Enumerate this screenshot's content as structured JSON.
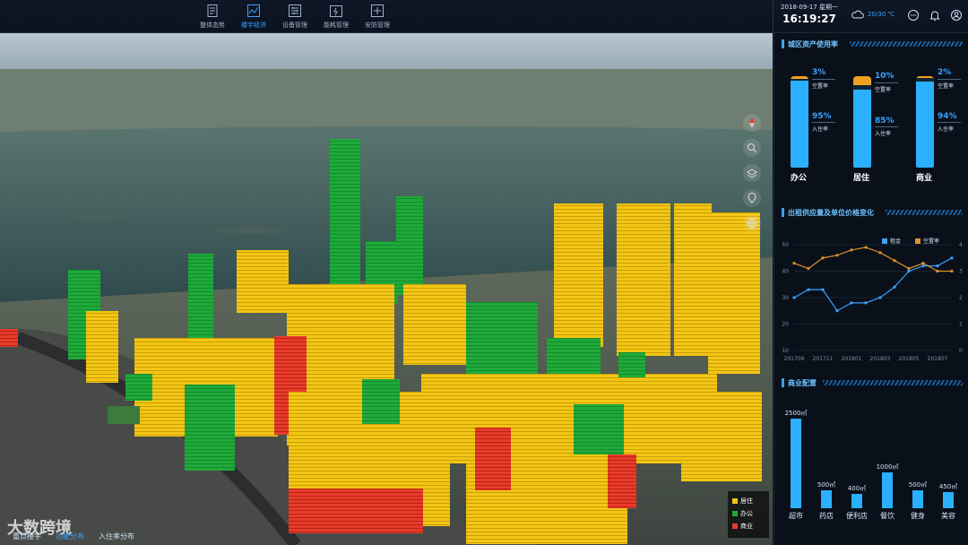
{
  "nav": {
    "items": [
      {
        "label": "整体态势",
        "icon": "document-icon"
      },
      {
        "label": "楼宇经济",
        "icon": "line-chart-icon",
        "active": true
      },
      {
        "label": "设备管理",
        "icon": "sliders-icon"
      },
      {
        "label": "能耗管理",
        "icon": "energy-icon"
      },
      {
        "label": "安防管理",
        "icon": "security-icon"
      }
    ]
  },
  "header": {
    "date": "2018-09-17 星期一",
    "time": "16:19:27",
    "weather": "20/30 ℃",
    "weather_icon": "cloud-icon",
    "icons": [
      "chat-icon",
      "bell-icon",
      "user-icon"
    ]
  },
  "panel1": {
    "title": "城区资产使用率",
    "vacancy_label": "空置率",
    "occupancy_label": "入住率",
    "items": [
      {
        "name": "办公",
        "vacancy": "3%",
        "occupancy": "95%",
        "vac": 3,
        "occ": 95
      },
      {
        "name": "居住",
        "vacancy": "10%",
        "occupancy": "85%",
        "vac": 10,
        "occ": 85
      },
      {
        "name": "商业",
        "vacancy": "2%",
        "occupancy": "94%",
        "vac": 2,
        "occ": 94
      }
    ]
  },
  "panel2": {
    "title": "出租供应量及单位价格变化",
    "legend_rent": "租金",
    "legend_vacancy": "空置率",
    "color_rent": "#3aa2ff",
    "color_vacancy": "#e0902a"
  },
  "chart_data": [
    {
      "type": "line",
      "title": "出租供应量及单位价格变化",
      "x": [
        "201709",
        "201710",
        "201711",
        "201712",
        "201801",
        "201802",
        "201803",
        "201804",
        "201805",
        "201806",
        "201807",
        "201808"
      ],
      "x_tick_labels": [
        "201709",
        "201711",
        "201801",
        "201803",
        "201805",
        "201807"
      ],
      "y_left_ticks": [
        "10",
        "20",
        "30",
        "40",
        "50"
      ],
      "y_right_ticks": [
        "0",
        "1",
        "2",
        "3",
        "4"
      ],
      "ylim_left": [
        10,
        50
      ],
      "ylim_right": [
        0,
        4
      ],
      "series": [
        {
          "name": "租金",
          "axis": "left",
          "color": "#3aa2ff",
          "values": [
            30,
            33,
            33,
            25,
            28,
            28,
            30,
            34,
            40,
            42,
            42,
            45
          ]
        },
        {
          "name": "空置率",
          "axis": "right",
          "color": "#e0902a",
          "values": [
            3.3,
            3.1,
            3.5,
            3.6,
            3.8,
            3.9,
            3.7,
            3.4,
            3.1,
            3.3,
            3.0,
            3.0
          ]
        }
      ],
      "grid": true,
      "legend": "top-right"
    },
    {
      "type": "bar",
      "title": "商业配置",
      "categories": [
        "超市",
        "药店",
        "便利店",
        "餐饮",
        "健身",
        "美容"
      ],
      "labels": [
        "2500㎡",
        "500㎡",
        "400㎡",
        "1000㎡",
        "500㎡",
        "450㎡"
      ],
      "values": [
        2500,
        500,
        400,
        1000,
        500,
        450
      ],
      "ylim": [
        0,
        2500
      ]
    }
  ],
  "panel3": {
    "title": "商业配置"
  },
  "map_legend": {
    "items": [
      {
        "label": "居住",
        "color": "#f3c614"
      },
      {
        "label": "办公",
        "color": "#1faa3a"
      },
      {
        "label": "商业",
        "color": "#e83b2a"
      }
    ]
  },
  "bottom_tabs": [
    "重点楼宇",
    "功能分布",
    "入住率分布"
  ],
  "watermark": "大数跨境"
}
